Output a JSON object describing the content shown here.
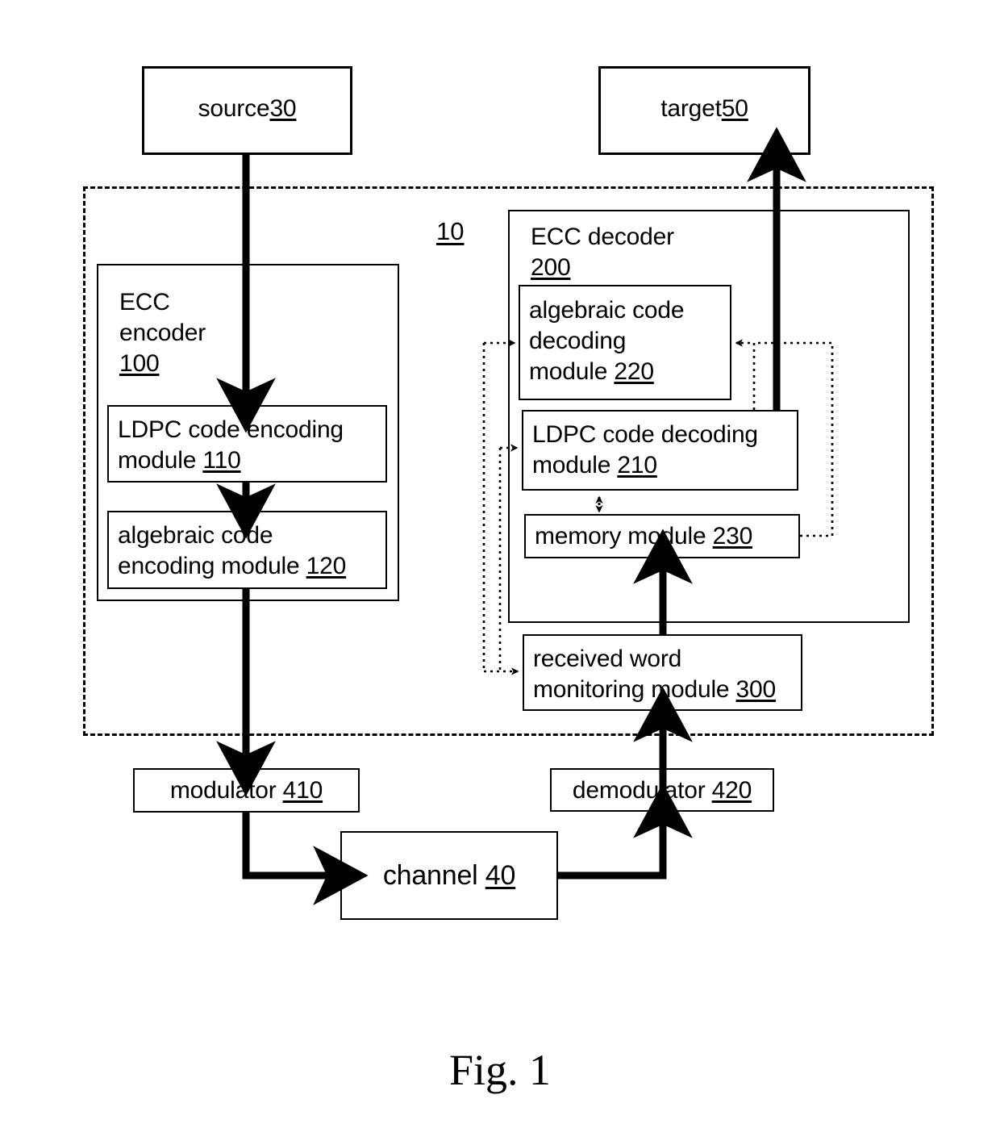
{
  "figure": {
    "caption": "Fig. 1",
    "system_ref": "10"
  },
  "nodes": {
    "source": {
      "name": "source",
      "ref": "30"
    },
    "target": {
      "name": "target",
      "ref": "50"
    },
    "ecc_encoder": {
      "name": "ECC\nencoder",
      "ref": "100"
    },
    "ldpc_encoding_module": {
      "name": "LDPC code encoding\nmodule ",
      "ref": "110"
    },
    "algebraic_encoding_module": {
      "name": "algebraic code\nencoding module ",
      "ref": "120"
    },
    "ecc_decoder": {
      "name": "ECC decoder\n",
      "ref": "200"
    },
    "algebraic_decoding_module": {
      "name": "algebraic code\ndecoding\nmodule ",
      "ref": "220"
    },
    "ldpc_decoding_module": {
      "name": "LDPC code decoding\nmodule ",
      "ref": "210"
    },
    "memory_module": {
      "name": "memory module ",
      "ref": "230"
    },
    "received_word_monitoring_module": {
      "name": "received word\nmonitoring module ",
      "ref": "300"
    },
    "modulator": {
      "name": "modulator ",
      "ref": "410"
    },
    "demodulator": {
      "name": "demodulator ",
      "ref": "420"
    },
    "channel": {
      "name": "channel ",
      "ref": "40"
    }
  },
  "colors": {
    "stroke": "#000000",
    "background": "#ffffff"
  }
}
